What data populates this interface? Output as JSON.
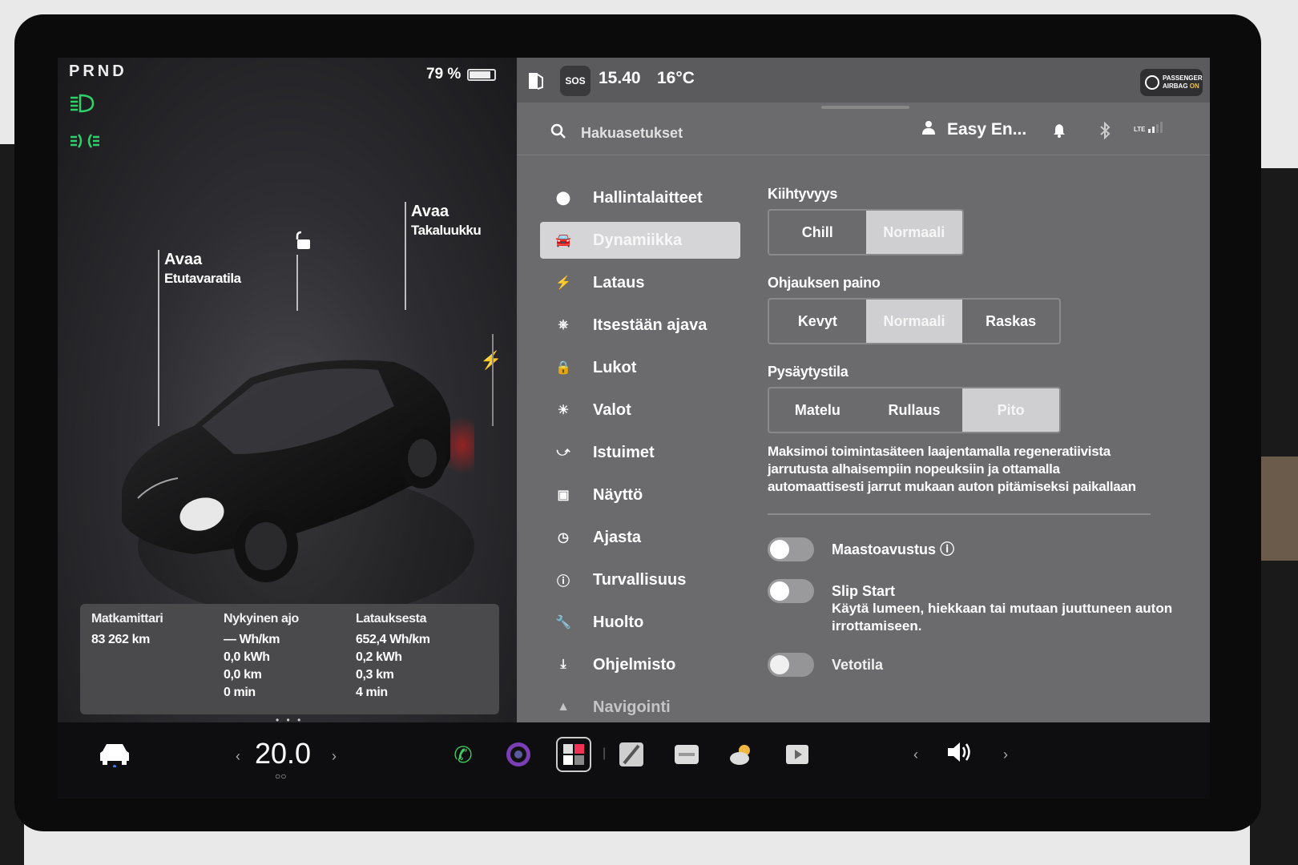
{
  "left": {
    "gear": "PRND",
    "battery_percent_text": "79 %",
    "battery_level": 0.79,
    "frunk_title": "Avaa",
    "frunk_sub": "Etutavaratila",
    "trunk_title": "Avaa",
    "trunk_sub": "Takaluukku",
    "trip": {
      "odometer_label": "Matkamittari",
      "odometer_value": "83 262 km",
      "current_label": "Nykyinen ajo",
      "current_values": [
        "— Wh/km",
        "0,0 kWh",
        "0,0 km",
        "0 min"
      ],
      "since_charge_label": "Latauksesta",
      "since_charge_values": [
        "652,4 Wh/km",
        "0,2 kWh",
        "0,3 km",
        "4 min"
      ]
    },
    "page_dots": "• • •"
  },
  "topbar": {
    "sos_label": "SOS",
    "time": "15.40",
    "temperature": "16°C",
    "airbag_line1": "PASSENGER",
    "airbag_line2": "AIRBAG",
    "airbag_state": "ON"
  },
  "search": {
    "placeholder": "Hakuasetukset"
  },
  "status": {
    "user_name": "Easy En...",
    "lte_label": "LTE"
  },
  "menu": {
    "items": [
      {
        "label": "Hallintalaitteet"
      },
      {
        "label": "Dynamiikka"
      },
      {
        "label": "Lataus"
      },
      {
        "label": "Itsestään ajava"
      },
      {
        "label": "Lukot"
      },
      {
        "label": "Valot"
      },
      {
        "label": "Istuimet"
      },
      {
        "label": "Näyttö"
      },
      {
        "label": "Ajasta"
      },
      {
        "label": "Turvallisuus"
      },
      {
        "label": "Huolto"
      },
      {
        "label": "Ohjelmisto"
      },
      {
        "label": "Navigointi"
      }
    ],
    "active_index": 1
  },
  "settings": {
    "acceleration": {
      "title": "Kiihtyvyys",
      "options": [
        "Chill",
        "Normaali"
      ],
      "selected": "Normaali"
    },
    "steering": {
      "title": "Ohjauksen paino",
      "options": [
        "Kevyt",
        "Normaali",
        "Raskas"
      ],
      "selected": "Normaali"
    },
    "stopping": {
      "title": "Pysäytystila",
      "options": [
        "Matelu",
        "Rullaus",
        "Pito"
      ],
      "selected": "Pito"
    },
    "stopping_desc": "Maksimoi toimintasäteen laajentamalla regeneratiivista jarrutusta alhaisempiin nopeuksiin ja ottamalla automaattisesti jarrut mukaan auton pitämiseksi paikallaan",
    "offroad_label": "Maastoavustus",
    "slipstart_label": "Slip Start",
    "slipstart_desc": "Käytä lumeen, hiekkaan tai mutaan juuttuneen auton irrottamiseen.",
    "tow_label": "Vetotila"
  },
  "bottom": {
    "climate_temp": "20.0"
  },
  "colors": {
    "headlight_green": "#2fd16a",
    "airbag_on": "#f3c23b",
    "phone_green": "#3ccf5e"
  }
}
